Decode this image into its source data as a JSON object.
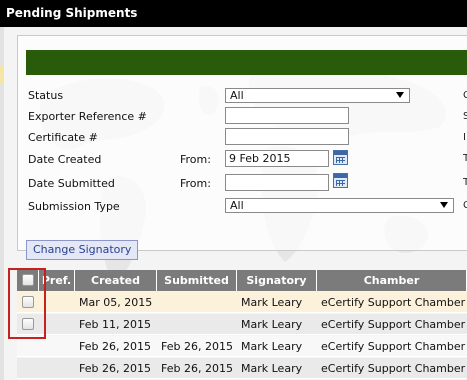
{
  "window": {
    "title": "Pending Shipments"
  },
  "form": {
    "status_label": "Status",
    "status_value": "All",
    "exporter_ref_label": "Exporter Reference #",
    "exporter_ref_value": "",
    "certificate_label": "Certificate #",
    "certificate_value": "",
    "date_created_label": "Date Created",
    "date_created_from_label": "From:",
    "date_created_from_value": "9 Feb 2015",
    "date_submitted_label": "Date Submitted",
    "date_submitted_from_label": "From:",
    "date_submitted_from_value": "",
    "submission_type_label": "Submission Type",
    "submission_type_value": "All",
    "right_edge_chars": [
      "C",
      "S",
      "I",
      "T",
      "T",
      "C"
    ]
  },
  "toolbar": {
    "change_signatory_label": "Change Signatory"
  },
  "table": {
    "headers": [
      "",
      "Pref.",
      "Created",
      "Submitted",
      "Signatory",
      "Chamber"
    ],
    "rows": [
      {
        "created": "Mar 05, 2015",
        "submitted": "",
        "signatory": "Mark Leary",
        "chamber": "eCertify Support Chamber",
        "highlighted": true,
        "checkbox": true
      },
      {
        "created": "Feb 11, 2015",
        "submitted": "",
        "signatory": "Mark Leary",
        "chamber": "eCertify Support Chamber",
        "highlighted": false,
        "checkbox": true
      },
      {
        "created": "Feb 26, 2015",
        "submitted": "Feb 26, 2015",
        "signatory": "Mark Leary",
        "chamber": "eCertify Support Chamber",
        "highlighted": false,
        "checkbox": false
      },
      {
        "created": "Feb 26, 2015",
        "submitted": "Feb 26, 2015",
        "signatory": "Mark Leary",
        "chamber": "eCertify Support Chamber",
        "highlighted": false,
        "checkbox": false
      }
    ]
  },
  "colors": {
    "titlebar": "#000000",
    "green_bar": "#295c0a",
    "table_header": "#7b7b7b",
    "row_highlight": "#fcf2dc",
    "row_even": "#eaeaea",
    "selection_outline": "#c42121"
  }
}
